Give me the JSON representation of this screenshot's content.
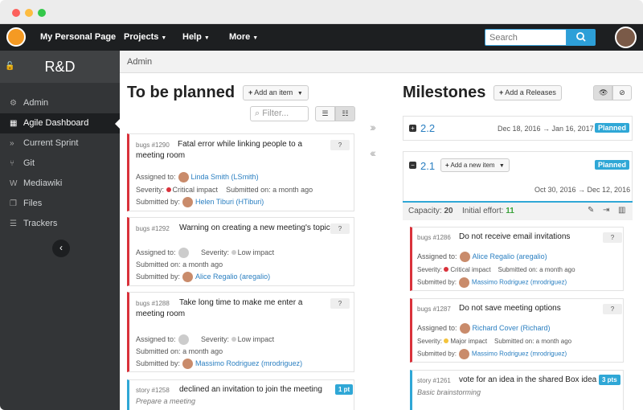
{
  "nav": {
    "title": "My Personal Page",
    "projects": "Projects",
    "help": "Help",
    "more": "More",
    "search_placeholder": "Search"
  },
  "sidebar": {
    "project": "R&D",
    "items": [
      {
        "label": "Admin",
        "icon": "gears-icon"
      },
      {
        "label": "Agile Dashboard",
        "icon": "dashboard-icon"
      },
      {
        "label": "Current Sprint",
        "icon": "chevrons-icon"
      },
      {
        "label": "Git",
        "icon": "git-icon"
      },
      {
        "label": "Mediawiki",
        "icon": "wiki-icon"
      },
      {
        "label": "Files",
        "icon": "files-icon"
      },
      {
        "label": "Trackers",
        "icon": "list-icon"
      }
    ]
  },
  "breadcrumb": "Admin",
  "left": {
    "title": "To be planned",
    "add_btn": "Add an item",
    "filter_placeholder": "Filter..."
  },
  "cards": [
    {
      "type": "bugs #1290",
      "title": "Fatal error while linking people to a meeting room",
      "assigned_label": "Assigned to:",
      "assigned": "Linda Smith (LSmith)",
      "severity_label": "Severity:",
      "severity": "Critical impact",
      "submitted_on_label": "Submitted on:",
      "submitted_on": "a month ago",
      "submitted_by_label": "Submitted by:",
      "submitted_by": "Helen Tiburi (HTiburi)",
      "badge": "?"
    },
    {
      "type": "bugs #1292",
      "title": "Warning on creating a new meeting's topic",
      "assigned_label": "Assigned to:",
      "severity_label": "Severity:",
      "severity": "Low impact",
      "submitted_on_label": "Submitted on:",
      "submitted_on": "a month ago",
      "submitted_by_label": "Submitted by:",
      "submitted_by": "Alice Regalio (aregalio)",
      "badge": "?"
    },
    {
      "type": "bugs #1288",
      "title": "Take long time to make me enter a meeting room",
      "assigned_label": "Assigned to:",
      "severity_label": "Severity:",
      "severity": "Low impact",
      "submitted_on_label": "Submitted on:",
      "submitted_on": "a month ago",
      "submitted_by_label": "Submitted by:",
      "submitted_by": "Massimo Rodriguez (mrodriguez)",
      "badge": "?"
    },
    {
      "type": "story #1258",
      "title": "declined an invitation to join the meeting",
      "subtitle": "Prepare a meeting",
      "badge": "1 pt"
    }
  ],
  "right": {
    "title": "Milestones",
    "add_btn": "Add a Releases"
  },
  "milestones": [
    {
      "num": "2.2",
      "dates": "Dec 18, 2016 → Jan 16, 2017",
      "status": "Planned"
    },
    {
      "num": "2.1",
      "add_btn": "Add a new item",
      "dates": "Oct 30, 2016 → Dec 12, 2016",
      "status": "Planned"
    }
  ],
  "capacity": {
    "cap_label": "Capacity:",
    "cap": "20",
    "effort_label": "Initial effort:",
    "effort": "11"
  },
  "mcards": [
    {
      "type": "bugs #1286",
      "title": "Do not receive email invitations",
      "assigned_label": "Assigned to:",
      "assigned": "Alice Regalio (aregalio)",
      "severity_label": "Severity:",
      "severity": "Critical impact",
      "submitted_on_label": "Submitted on:",
      "submitted_on": "a month ago",
      "submitted_by_label": "Submitted by:",
      "submitted_by": "Massimo Rodriguez (mrodriguez)",
      "badge": "?"
    },
    {
      "type": "bugs #1287",
      "title": "Do not save meeting options",
      "assigned_label": "Assigned to:",
      "assigned": "Richard Cover (Richard)",
      "severity_label": "Severity:",
      "severity": "Major impact",
      "submitted_on_label": "Submitted on:",
      "submitted_on": "a month ago",
      "submitted_by_label": "Submitted by:",
      "submitted_by": "Massimo Rodriguez (mrodriguez)",
      "badge": "?"
    },
    {
      "type": "story #1261",
      "title": "vote for an idea in the shared Box idea",
      "subtitle": "Basic brainstorming",
      "badge": "3 pts"
    }
  ]
}
